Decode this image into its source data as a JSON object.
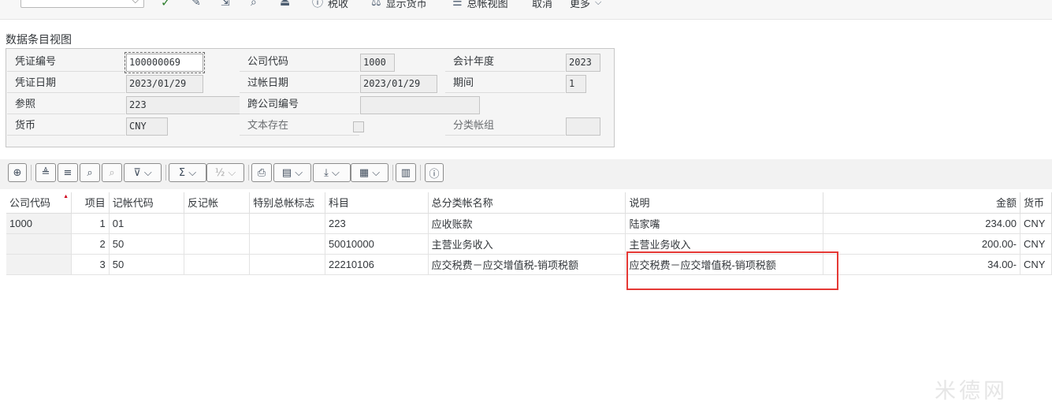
{
  "toolbar": {
    "items": [
      {
        "icon": "checkmark-icon",
        "label": ""
      },
      {
        "icon": "edit-icon",
        "label": ""
      },
      {
        "icon": "export-icon",
        "label": ""
      },
      {
        "icon": "search-icon",
        "label": ""
      },
      {
        "icon": "stamp-icon",
        "label": ""
      },
      {
        "icon": "info-icon",
        "label": "税收"
      },
      {
        "icon": "currency-icon",
        "label": "显示货币"
      },
      {
        "icon": "ledger-icon",
        "label": "总帐视图"
      },
      {
        "icon": "",
        "label": "取消"
      },
      {
        "icon": "chevron-down-icon",
        "label": "更多"
      }
    ]
  },
  "section": {
    "title": "数据条目视图"
  },
  "header": {
    "doc_no_label": "凭证编号",
    "doc_no": "100000069",
    "company_label": "公司代码",
    "company": "1000",
    "fiscal_year_label": "会计年度",
    "fiscal_year": "2023",
    "doc_date_label": "凭证日期",
    "doc_date": "2023/01/29",
    "posting_date_label": "过帐日期",
    "posting_date": "2023/01/29",
    "period_label": "期间",
    "period": "1",
    "reference_label": "参照",
    "reference": "223",
    "cross_cc_label": "跨公司编号",
    "cross_cc": "",
    "currency_label": "货币",
    "currency": "CNY",
    "text_exists_label": "文本存在",
    "ledger_group_label": "分类帐组",
    "ledger_group": ""
  },
  "grid_toolbar": {
    "buttons": [
      "zoom-in-icon",
      "sort-ascending-icon",
      "sort-descending-icon",
      "find-icon",
      "find-next-icon",
      "filter-icon",
      "sum-icon",
      "subtotal-icon",
      "print-icon",
      "view-icon",
      "export-icon",
      "layout-icon",
      "chart-icon",
      "info-icon"
    ]
  },
  "table": {
    "columns": [
      "公司代码",
      "项目",
      "记帐代码",
      "反记帐",
      "特别总帐标志",
      "科目",
      "总分类帐名称",
      "说明",
      "金额",
      "货币"
    ],
    "rows": [
      {
        "company": "1000",
        "item": "1",
        "posting_key": "01",
        "reversal": "",
        "special_gl": "",
        "account": "223",
        "gl_name": "应收账款",
        "text": "陆家嘴",
        "amount": "234.00",
        "currency": "CNY"
      },
      {
        "company": "",
        "item": "2",
        "posting_key": "50",
        "reversal": "",
        "special_gl": "",
        "account": "50010000",
        "gl_name": "主营业务收入",
        "text": "主营业务收入",
        "amount": "200.00-",
        "currency": "CNY"
      },
      {
        "company": "",
        "item": "3",
        "posting_key": "50",
        "reversal": "",
        "special_gl": "",
        "account": "22210106",
        "gl_name": "应交税费－应交增值税-销项税额",
        "text": "应交税费－应交增值税-销项税额",
        "amount": "34.00-",
        "currency": "CNY"
      }
    ]
  },
  "watermark": "米德网"
}
